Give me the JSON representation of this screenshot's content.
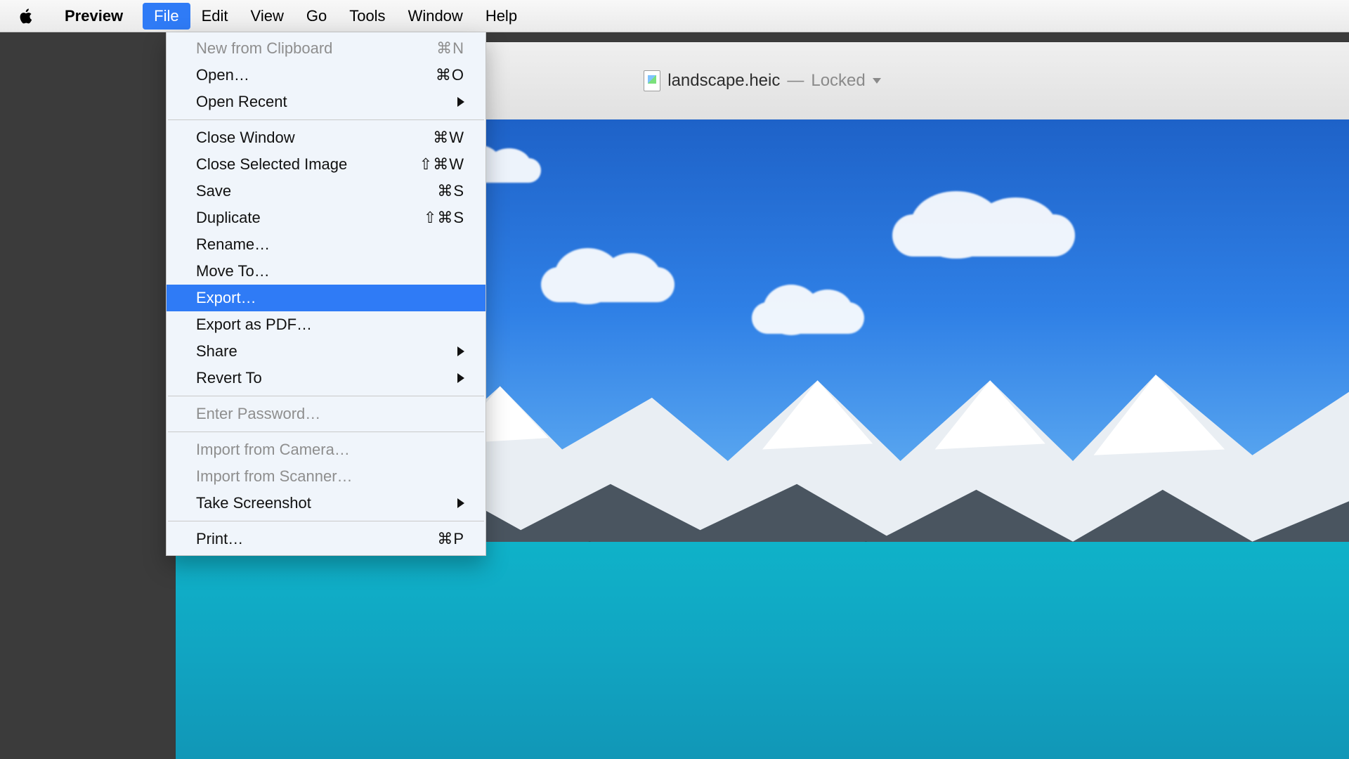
{
  "menubar": {
    "app_name": "Preview",
    "items": [
      {
        "label": "File",
        "active": true
      },
      {
        "label": "Edit"
      },
      {
        "label": "View"
      },
      {
        "label": "Go"
      },
      {
        "label": "Tools"
      },
      {
        "label": "Window"
      },
      {
        "label": "Help"
      }
    ]
  },
  "file_menu": {
    "groups": [
      [
        {
          "label": "New from Clipboard",
          "shortcut": "⌘N",
          "disabled": true
        },
        {
          "label": "Open…",
          "shortcut": "⌘O"
        },
        {
          "label": "Open Recent",
          "submenu": true
        }
      ],
      [
        {
          "label": "Close Window",
          "shortcut": "⌘W"
        },
        {
          "label": "Close Selected Image",
          "shortcut": "⇧⌘W"
        },
        {
          "label": "Save",
          "shortcut": "⌘S"
        },
        {
          "label": "Duplicate",
          "shortcut": "⇧⌘S"
        },
        {
          "label": "Rename…"
        },
        {
          "label": "Move To…"
        },
        {
          "label": "Export…",
          "highlight": true
        },
        {
          "label": "Export as PDF…"
        },
        {
          "label": "Share",
          "submenu": true
        },
        {
          "label": "Revert To",
          "submenu": true
        }
      ],
      [
        {
          "label": "Enter Password…",
          "disabled": true
        }
      ],
      [
        {
          "label": "Import from Camera…",
          "disabled": true
        },
        {
          "label": "Import from Scanner…",
          "disabled": true
        },
        {
          "label": "Take Screenshot",
          "submenu": true
        }
      ],
      [
        {
          "label": "Print…",
          "shortcut": "⌘P"
        }
      ]
    ]
  },
  "window": {
    "doc_title": "landscape.heic",
    "doc_status_prefix": "—",
    "doc_status": "Locked"
  }
}
